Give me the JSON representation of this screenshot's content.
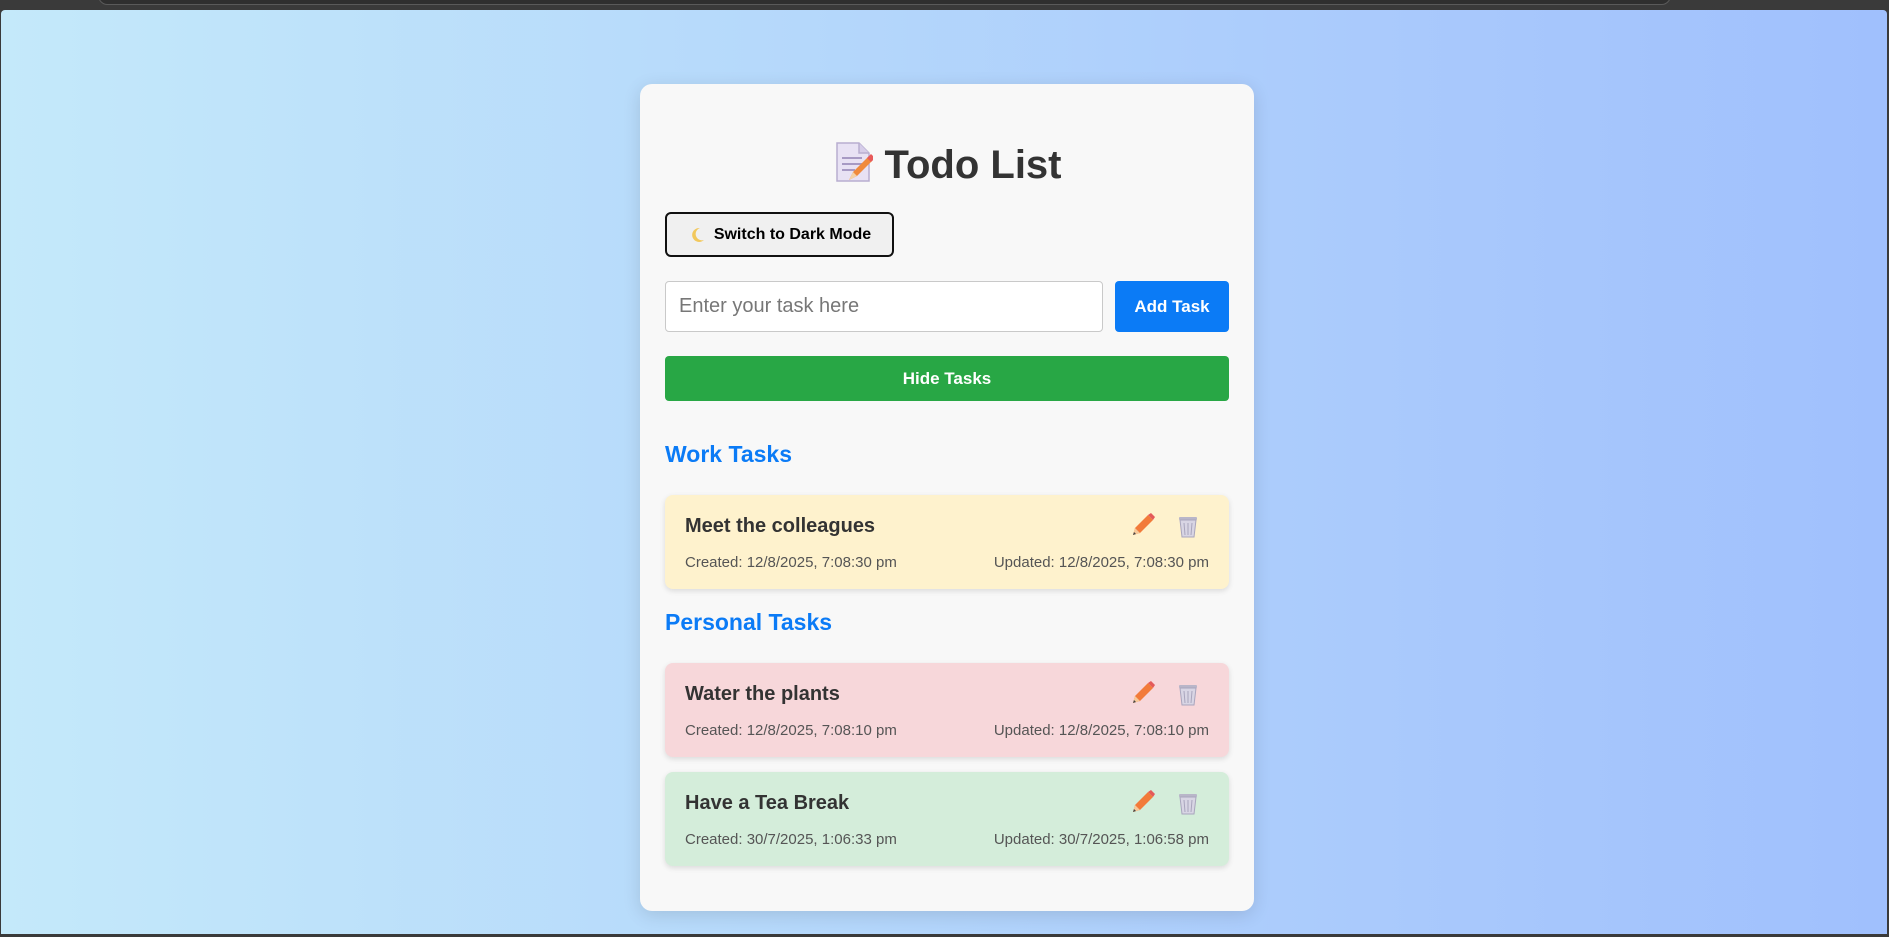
{
  "app": {
    "title": "Todo List",
    "title_icon": "memo-icon"
  },
  "theme_toggle": {
    "label": "Switch to Dark Mode",
    "icon": "crescent-moon-icon"
  },
  "input": {
    "placeholder": "Enter your task here",
    "value": ""
  },
  "add_button": {
    "label": "Add Task"
  },
  "hide_button": {
    "label": "Hide Tasks"
  },
  "colors": {
    "accent": "#0b7bf6",
    "success": "#28a745",
    "work_card": "#fef2cd",
    "personal_card_1": "#f7d7da",
    "personal_card_2": "#d4edda"
  },
  "sections": [
    {
      "title": "Work Tasks",
      "tasks": [
        {
          "name": "Meet the colleagues",
          "created": "Created: 12/8/2025, 7:08:30 pm",
          "updated": "Updated: 12/8/2025, 7:08:30 pm"
        }
      ]
    },
    {
      "title": "Personal Tasks",
      "tasks": [
        {
          "name": "Water the plants",
          "created": "Created: 12/8/2025, 7:08:10 pm",
          "updated": "Updated: 12/8/2025, 7:08:10 pm"
        },
        {
          "name": "Have a Tea Break",
          "created": "Created: 30/7/2025, 1:06:33 pm",
          "updated": "Updated: 30/7/2025, 1:06:58 pm"
        }
      ]
    }
  ]
}
